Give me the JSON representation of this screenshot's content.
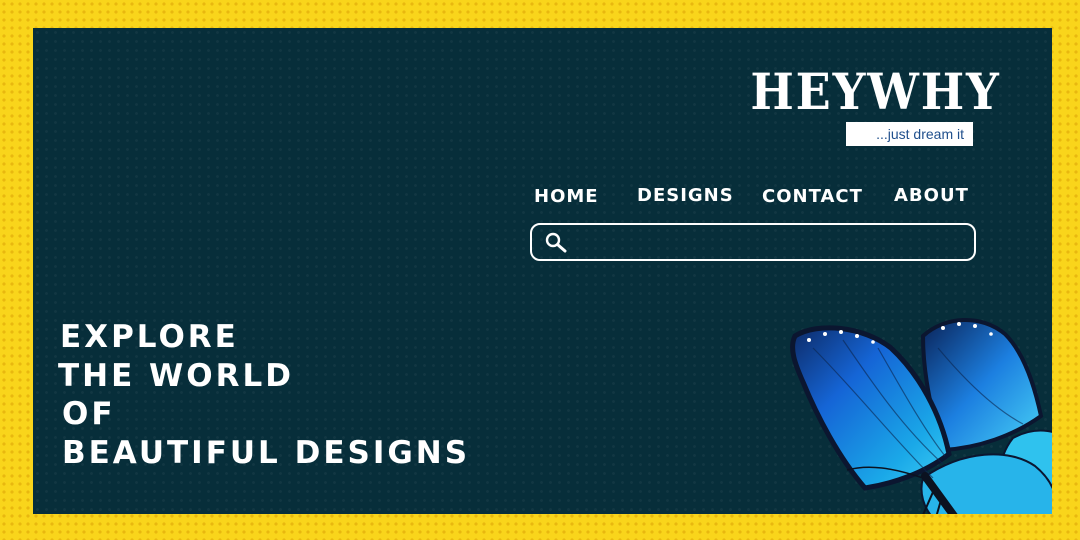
{
  "brand": {
    "name": "HEYWHY",
    "tagline": "...just dream it"
  },
  "nav": {
    "items": [
      {
        "label": "HOME"
      },
      {
        "label": "DESIGNS"
      },
      {
        "label": "CONTACT"
      },
      {
        "label": "ABOUT"
      }
    ]
  },
  "search": {
    "icon": "search-icon",
    "value": "",
    "placeholder": ""
  },
  "hero": {
    "lines": [
      "EXPLORE",
      "THE WORLD",
      "OF",
      "BEAUTIFUL DESIGNS"
    ]
  },
  "illustration": {
    "icon": "butterfly-icon"
  },
  "colors": {
    "background": "#f9d51b",
    "panel": "#072e3a",
    "text": "#ffffff",
    "tagline_text": "#1f4f8c",
    "butterfly_blue": "#1aa8e8"
  }
}
